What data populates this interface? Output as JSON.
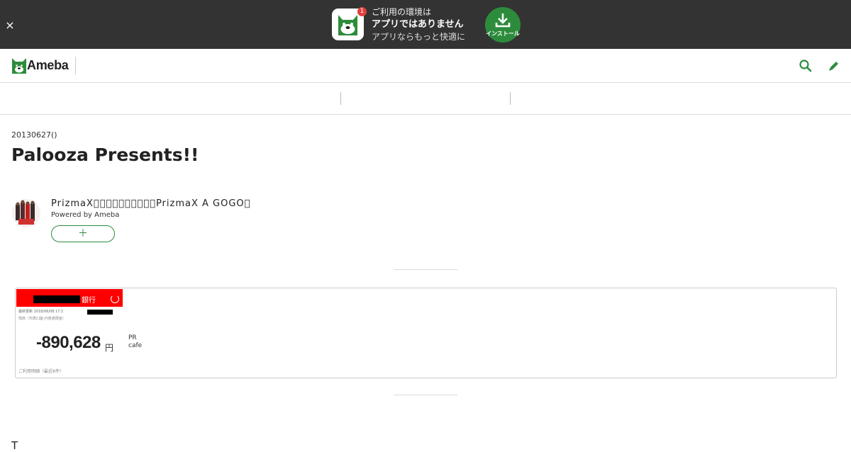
{
  "promo": {
    "close_glyph": "×",
    "badge": "1",
    "line1": "ご利用の環境は",
    "line2": "アプリではありません",
    "line3": "アプリならもっと快適に",
    "install_label": "インストール",
    "app_icon": "ameba-app-icon",
    "install_icon": "download-icon",
    "bg_color": "#333333",
    "install_color": "#2d8c3c"
  },
  "header": {
    "logo_text": "Ameba",
    "search_icon": "search-icon",
    "edit_icon": "pencil-icon",
    "accent_color": "#2d8c3c"
  },
  "article": {
    "date": "20130627()",
    "title": "Palooza Presents!!"
  },
  "blog": {
    "name": "PrizmaX\u0000\u0000\u0000\u0000\u0000\u0000\u0000\u0000\u0000\u0000PrizmaX A GOGO\u0000",
    "powered": "Powered by Ameba",
    "follow_label": "＋"
  },
  "ad": {
    "bank_label": "銀行",
    "meta1": "最終更新 2018/06/08 17:2",
    "meta2": "残高（代表口座-円普通預金）",
    "amount": "-890,628",
    "yen": "円",
    "footer": "ご利用明細（最近8件）",
    "pr": "PR",
    "category": "cafe"
  },
  "body_start": "T"
}
